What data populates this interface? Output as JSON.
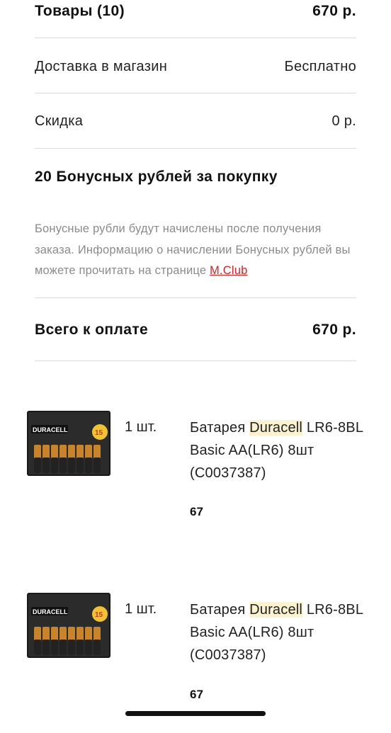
{
  "summary": {
    "items_label": "Товары (10)",
    "items_value": "670 р.",
    "delivery_label": "Доставка в магазин",
    "delivery_value": "Бесплатно",
    "discount_label": "Скидка",
    "discount_value": "0 р.",
    "bonus_title": "20 Бонусных рублей за покупку",
    "bonus_note_text": "Бонусные рубли будут начислены после получения заказа. Информацию о начислении Бонусных рублей вы можете прочитать на странице ",
    "bonus_link": "M.Club",
    "total_label": "Всего к оплате",
    "total_value": "670 р."
  },
  "products": [
    {
      "qty": "1 шт.",
      "name_prefix": "Батарея ",
      "name_highlight": "Duracell",
      "name_suffix": " LR6-8BL Basic AA(LR6) 8шт (C0037387)",
      "price": "67",
      "image_brand": "DURACELL",
      "image_badge": "15"
    },
    {
      "qty": "1 шт.",
      "name_prefix": "Батарея ",
      "name_highlight": "Duracell",
      "name_suffix": " LR6-8BL Basic AA(LR6) 8шт (C0037387)",
      "price": "67",
      "image_brand": "DURACELL",
      "image_badge": "15"
    }
  ],
  "colors": {
    "link": "#e02020",
    "highlight": "#fbf3d0",
    "divider": "#dcdcdc",
    "note": "#8b8b8b"
  },
  "icons": [
    "duracell-battery-pack-image",
    "home-indicator"
  ]
}
